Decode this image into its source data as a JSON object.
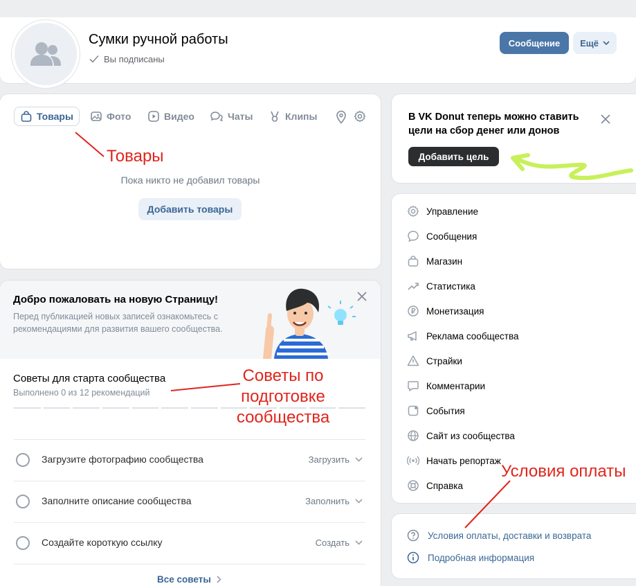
{
  "header": {
    "title": "Сумки ручной работы",
    "subscribed_label": "Вы подписаны",
    "message_button": "Сообщение",
    "more_button": "Ещё"
  },
  "tabs": [
    {
      "label": "Товары",
      "icon": "bag-icon",
      "active": true
    },
    {
      "label": "Фото",
      "icon": "photo-icon"
    },
    {
      "label": "Видео",
      "icon": "video-icon"
    },
    {
      "label": "Чаты",
      "icon": "chat-icon"
    },
    {
      "label": "Клипы",
      "icon": "clips-icon"
    }
  ],
  "goods": {
    "empty_text": "Пока никто не добавил товары",
    "add_button": "Добавить товары"
  },
  "welcome": {
    "title": "Добро пожаловать на новую Страницу!",
    "description": "Перед публикацией новых записей ознакомьтесь с рекомендациями для развития вашего сообщества."
  },
  "tips": {
    "title": "Советы для старта сообщества",
    "progress_text": "Выполнено 0 из 12 рекомендаций",
    "completed": 0,
    "total": 12,
    "tasks": [
      {
        "label": "Загрузите фотографию сообщества",
        "action": "Загрузить"
      },
      {
        "label": "Заполните описание сообщества",
        "action": "Заполнить"
      },
      {
        "label": "Создайте короткую ссылку",
        "action": "Создать"
      }
    ],
    "all_tips_label": "Все советы"
  },
  "donut": {
    "text": "В VK Donut теперь можно ставить цели на сбор денег или донов",
    "button": "Добавить цель"
  },
  "menu": [
    {
      "label": "Управление",
      "icon": "gear-icon"
    },
    {
      "label": "Сообщения",
      "icon": "message-icon"
    },
    {
      "label": "Магазин",
      "icon": "shop-bag-icon"
    },
    {
      "label": "Статистика",
      "icon": "statistics-icon"
    },
    {
      "label": "Монетизация",
      "icon": "ruble-coin-icon"
    },
    {
      "label": "Реклама сообщества",
      "icon": "megaphone-icon"
    },
    {
      "label": "Страйки",
      "icon": "warning-icon"
    },
    {
      "label": "Комментарии",
      "icon": "comment-icon"
    },
    {
      "label": "События",
      "icon": "event-icon"
    },
    {
      "label": "Сайт из сообщества",
      "icon": "globe-icon"
    },
    {
      "label": "Начать репортаж",
      "icon": "broadcast-icon"
    },
    {
      "label": "Справка",
      "icon": "help-lifebuoy-icon"
    }
  ],
  "info": [
    {
      "label": "Условия оплаты, доставки и возврата",
      "icon": "question-icon"
    },
    {
      "label": "Подробная информация",
      "icon": "info-icon"
    }
  ],
  "annotations": {
    "goods": "Товары",
    "tips": "Советы по подготовке сообщества",
    "payment": "Условия оплаты"
  },
  "colors": {
    "accent": "#4a76a8",
    "link": "#3a6796",
    "annotation": "#e0251c",
    "highlight_arrow": "#c8f05a"
  }
}
